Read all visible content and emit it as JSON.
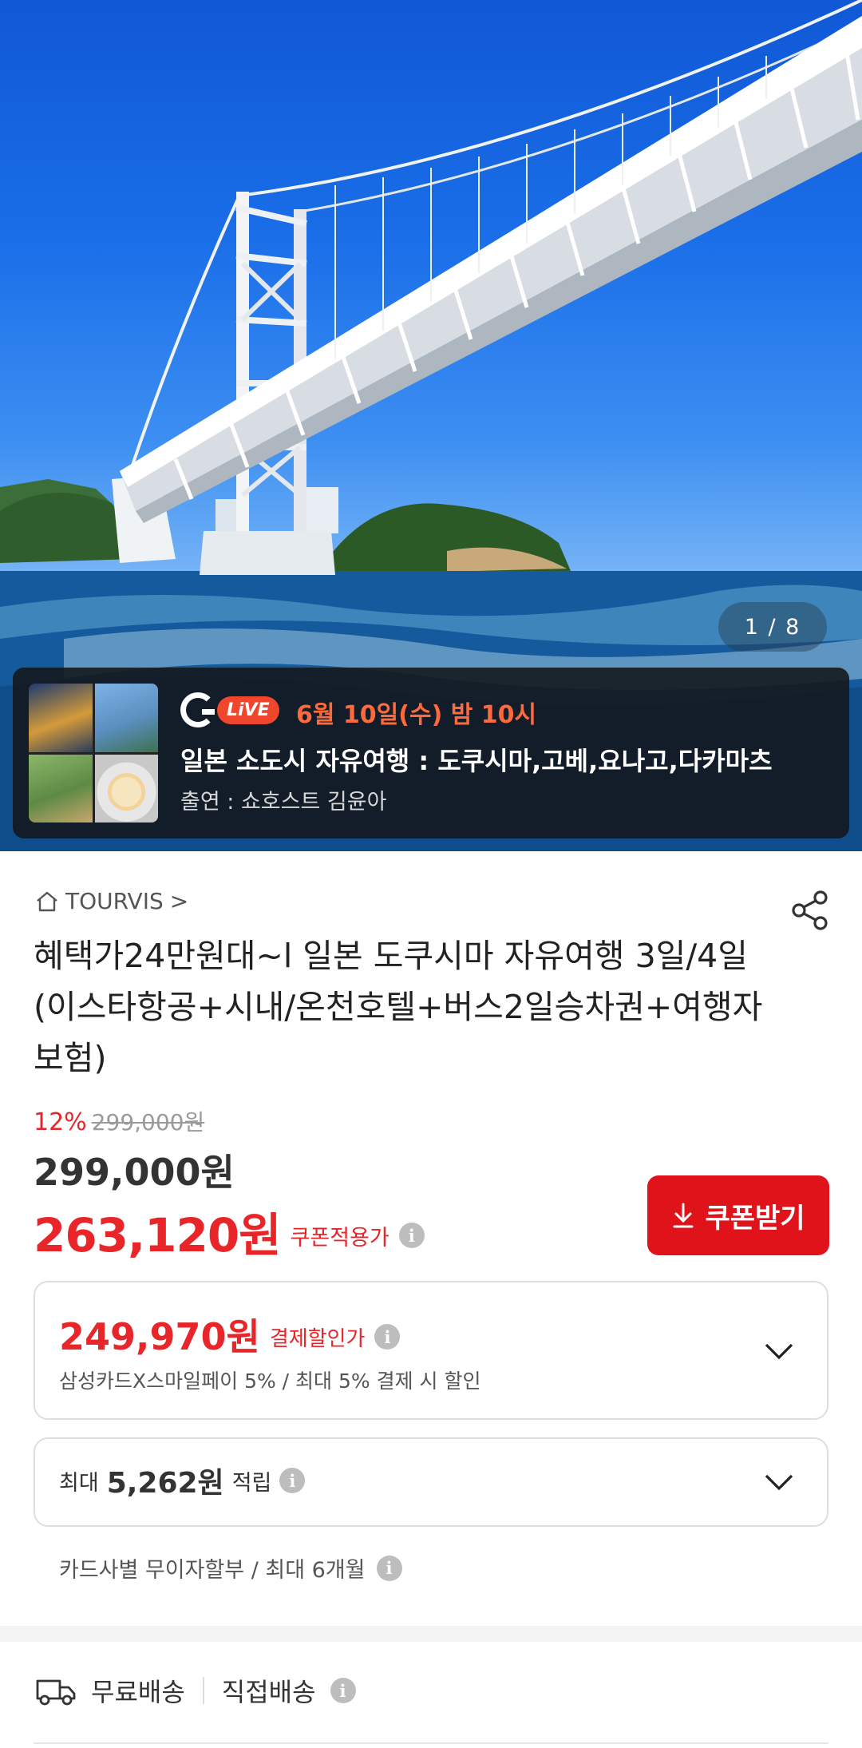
{
  "gallery": {
    "counter": "1 / 8"
  },
  "live": {
    "badge": "LiVE",
    "datetime": "6월 10일(수) 밤 10시",
    "title": "일본 소도시 자유여행 : 도쿠시마,고베,요나고,다카마츠",
    "host": "출연 : 쇼호스트 김윤아"
  },
  "product": {
    "brand": "TOURVIS",
    "brand_chevron": ">",
    "title": "혜택가24만원대~l 일본 도쿠시마 자유여행 3일/4일 (이스타항공+시내/온천호텔+버스2일승차권+여행자보험)",
    "discount_rate": "12%",
    "original_price": "299,000원",
    "sale_price": "299,000원",
    "coupon_price": "263,120원",
    "coupon_price_label": "쿠폰적용가",
    "coupon_button": "쿠폰받기"
  },
  "payment": {
    "price": "249,970원",
    "label": "결제할인가",
    "description": "삼성카드X스마일페이 5% / 최대 5% 결제 시 할인"
  },
  "points": {
    "prefix": "최대",
    "value": "5,262원",
    "suffix": "적립"
  },
  "installment": {
    "text": "카드사별 무이자할부 / 최대 6개월"
  },
  "shipping": {
    "free": "무료배송",
    "direct": "직접배송"
  },
  "icons": {
    "info_glyph": "i"
  },
  "colors": {
    "accent_red": "#e8262a",
    "button_red": "#e0121a",
    "live_orange": "#ff6a3d"
  }
}
